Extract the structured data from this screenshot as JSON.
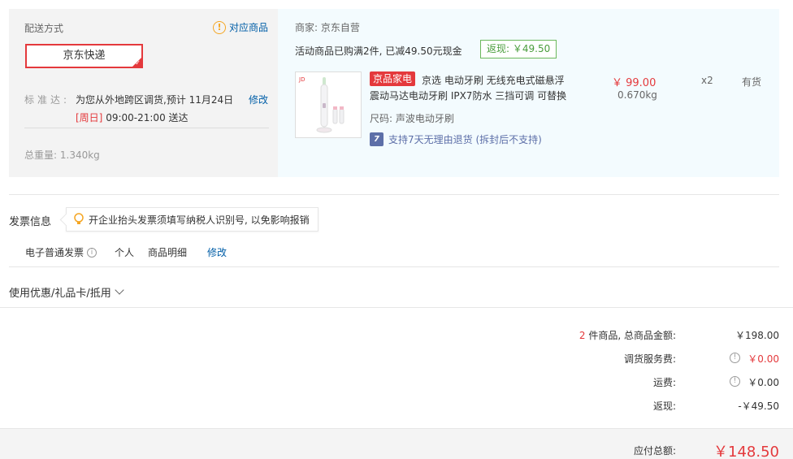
{
  "delivery": {
    "title": "配送方式",
    "corresponding_link": "对应商品",
    "method": "京东快递",
    "standard_label": "标准达:",
    "standard_text": "为您从外地跨区调货,预计 11月24日",
    "edit": "修改",
    "weekday": "[周日]",
    "time_window": "09:00-21:00 送达",
    "total_weight_label": "总重量:",
    "total_weight": "1.340kg"
  },
  "shop": {
    "merchant": "商家: 京东自营",
    "promo": "活动商品已购满2件, 已减49.50元现金",
    "rebate_tag": "返现: ￥49.50",
    "product": {
      "tag": "京品家电",
      "name_line1": "京选 电动牙刷 无线充电式磁悬浮",
      "name_line2": "震动马达电动牙刷 IPX7防水 三挡可调 可替换",
      "spec": "尺码: 声波电动牙刷",
      "return_policy": "支持7天无理由退货 (拆封后不支持)",
      "return_icon_text": "7",
      "price": "￥ 99.00",
      "weight": "0.670kg",
      "quantity": "x2",
      "stock": "有货"
    }
  },
  "invoice": {
    "title": "发票信息",
    "tip": "开企业抬头发票须填写纳税人识别号, 以免影响报销",
    "type": "电子普通发票",
    "person": "个人",
    "detail": "商品明细",
    "edit": "修改"
  },
  "coupon": {
    "label": "使用优惠/礼品卡/抵用"
  },
  "summary": {
    "item_count": "2",
    "items_label": " 件商品, 总商品金额:",
    "items_total": "￥198.00",
    "transfer_fee_label": "调货服务费:",
    "transfer_fee": "￥0.00",
    "shipping_label": "运费:",
    "shipping": "￥0.00",
    "rebate_label": "返现:",
    "rebate": "-￥49.50",
    "payable_label": "应付总额:",
    "payable": "￥148.50"
  },
  "icons": {
    "warning": "warning-circle-icon",
    "bulb": "lightbulb-icon",
    "info": "info-circle-icon",
    "check": "check-icon",
    "chevron": "chevron-down-icon"
  },
  "colors": {
    "brand_red": "#e4393c",
    "link_blue": "#005ea7",
    "rebate_green": "#4a9d3c",
    "warn_orange": "#f5a623"
  }
}
